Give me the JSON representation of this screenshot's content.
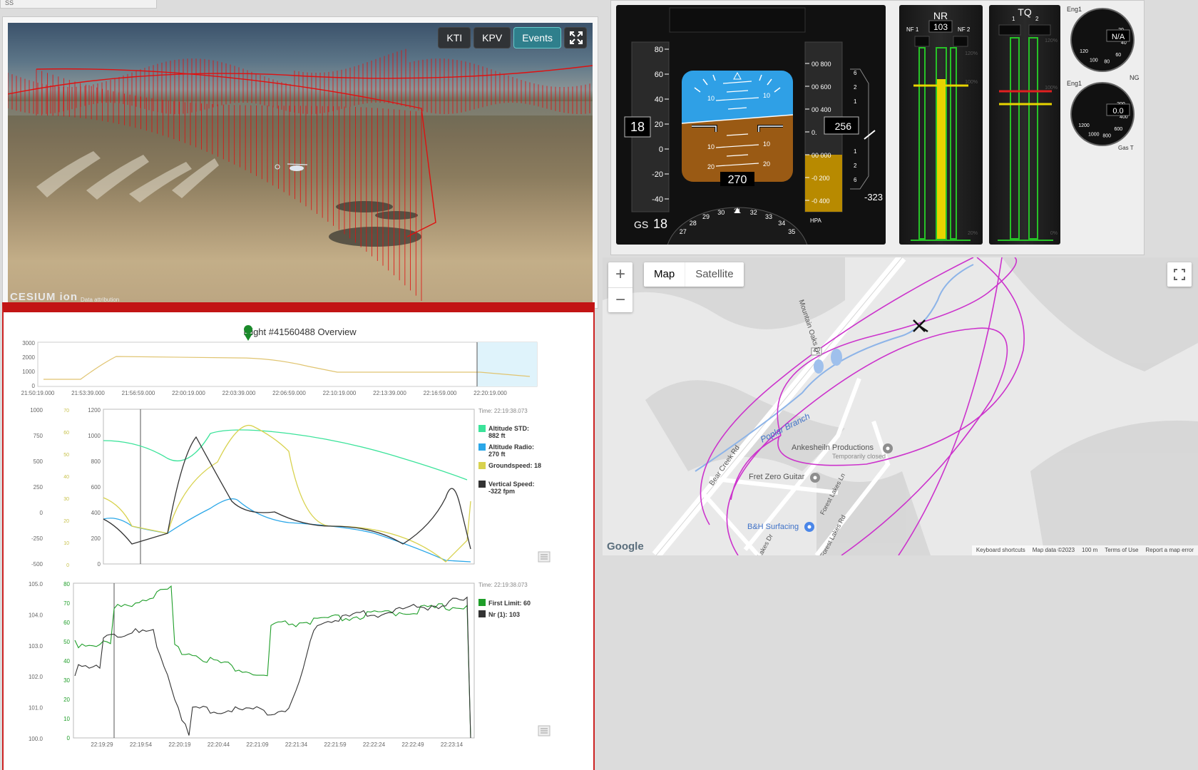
{
  "stub": {
    "label": "ŠS"
  },
  "viewer": {
    "buttons": {
      "kti": "KTI",
      "kpv": "KPV",
      "events": "Events"
    },
    "logo": "CESIUM ion",
    "attribution": "Data attribution"
  },
  "charts": {
    "title": "Flight #41560488 Overview",
    "overview": {
      "y_ticks": [
        "3000",
        "2000",
        "1000",
        "0"
      ],
      "x_ticks": [
        "21:50:19.000",
        "21:53:39.000",
        "21:56:59.000",
        "22:00:19.000",
        "22:03:39.000",
        "22:06:59.000",
        "22:10:19.000",
        "22:13:39.000",
        "22:16:59.000",
        "22:20:19.000"
      ]
    },
    "chart1": {
      "time": "Time: 22:19:38.073",
      "axis1": [
        "1000",
        "750",
        "500",
        "250",
        "0",
        "-250",
        "-500"
      ],
      "axis2": [
        "70",
        "60",
        "50",
        "40",
        "30",
        "20",
        "10",
        "0"
      ],
      "axis3": [
        "1200",
        "1000",
        "800",
        "600",
        "400",
        "200",
        "0"
      ],
      "legend": [
        {
          "name": "Altitude STD:",
          "value": "882 ft",
          "color": "#3be39a"
        },
        {
          "name": "Altitude Radio:",
          "value": "270 ft",
          "color": "#2ba7e8"
        },
        {
          "name": "Groundspeed: 18",
          "value": "",
          "color": "#d8d24e"
        },
        {
          "name": "Vertical Speed:",
          "value": "-322 fpm",
          "color": "#333333"
        }
      ]
    },
    "chart2": {
      "time": "Time: 22:19:38.073",
      "axis1": [
        "105.0",
        "104.0",
        "103.0",
        "102.0",
        "101.0",
        "100.0"
      ],
      "axis2": [
        "80",
        "70",
        "60",
        "50",
        "40",
        "30",
        "20",
        "10",
        "0"
      ],
      "x_ticks": [
        "22:19:29",
        "22:19:54",
        "22:20:19",
        "22:20:44",
        "22:21:09",
        "22:21:34",
        "22:21:59",
        "22:22:24",
        "22:22:49",
        "22:23:14"
      ],
      "legend": [
        {
          "name": "First Limit: 60",
          "color": "#1f9e29"
        },
        {
          "name": "Nr (1): 103",
          "color": "#333333"
        }
      ]
    }
  },
  "pfd": {
    "speed_ticks": [
      "80",
      "60",
      "40",
      "20",
      "0",
      "-20",
      "-40"
    ],
    "speed": "18",
    "gs_label": "GS",
    "gs_value": "18",
    "heading": "270",
    "pitch_labels": [
      "10",
      "10",
      "10",
      "10",
      "20",
      "20"
    ],
    "alt_ticks": [
      "00 800",
      "00 600",
      "00 400",
      "0.",
      "00 000",
      "-0 200",
      "-0 400"
    ],
    "alt_value": "256",
    "vs_ticks": [
      "6",
      "2",
      "1",
      "1",
      "2",
      "6"
    ],
    "vs_value": "-323",
    "hpa_label": "HPA",
    "compass": [
      "27",
      "28",
      "29",
      "30",
      "31",
      "32",
      "33",
      "34",
      "35"
    ]
  },
  "nr": {
    "title": "NR",
    "nf1": "NF 1",
    "nf2": "NF 2",
    "value": "103",
    "p120": "120%",
    "p100": "100%",
    "p20": "20%"
  },
  "tq": {
    "title": "TQ",
    "n1": "1",
    "n2": "2",
    "p120": "120%",
    "p100": "100%",
    "p0": "0%"
  },
  "eng": {
    "g1_label": "Eng1",
    "g1_value": "N/A",
    "g1_ticks": [
      "120",
      "100",
      "80",
      "60",
      "40",
      "20"
    ],
    "g1_name": "NG",
    "g2_label": "Eng1",
    "g2_value": "0.0",
    "g2_ticks": [
      "1200",
      "1000",
      "800",
      "600",
      "400",
      "200"
    ],
    "g2_name": "Gas T"
  },
  "map": {
    "zoom_in": "+",
    "zoom_out": "−",
    "types": [
      "Map",
      "Satellite"
    ],
    "labels": {
      "mountain_oaks": "Mountain Oaks Dr",
      "poplar": "Poplar Branch",
      "ankeshein": "Ankesheiln Productions",
      "ankeshein_sub": "Temporarily closed",
      "bear_creek": "Bear Creek Rd",
      "fret_zero": "Fret Zero Guitar",
      "forest_lakes": "Forest Lakes Ln",
      "bh": "B&H Surfacing",
      "route": "42",
      "lakes_dr": "Lakes Dr",
      "forest_lakes_rd": "Forest Lakes Rd"
    },
    "google": "Google",
    "footer": [
      "Keyboard shortcuts",
      "Map data ©2023",
      "100 m",
      "Terms of Use",
      "Report a map error"
    ]
  }
}
